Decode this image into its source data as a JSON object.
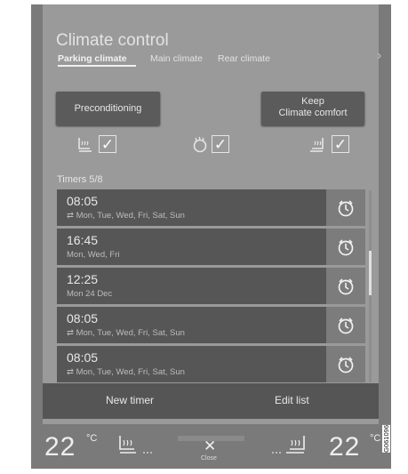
{
  "header": {
    "title": "Climate control",
    "tabs": [
      "Parking climate",
      "Main climate",
      "Rear climate"
    ]
  },
  "actions": {
    "preconditioning": "Preconditioning",
    "keep_comfort": "Keep\nClimate comfort"
  },
  "timers": {
    "label": "Timers 5/8",
    "items": [
      {
        "time": "08:05",
        "days": "Mon, Tue, Wed, Fri, Sat, Sun",
        "repeat": true
      },
      {
        "time": "16:45",
        "days": "Mon, Wed, Fri",
        "repeat": false
      },
      {
        "time": "12:25",
        "days": "Mon 24 Dec",
        "repeat": false
      },
      {
        "time": "08:05",
        "days": "Mon, Tue, Wed, Fri, Sat, Sun",
        "repeat": true
      },
      {
        "time": "08:05",
        "days": "Mon, Tue, Wed, Fri, Sat, Sun",
        "repeat": true
      }
    ]
  },
  "bottom": {
    "new_timer": "New timer",
    "edit_list": "Edit list"
  },
  "climate_bar": {
    "left_temp": "22",
    "right_temp": "22",
    "unit": "°C",
    "close_label": "Close"
  },
  "image_code": "G061096",
  "colors": {
    "screen": "#9a9a9a",
    "row": "#565656",
    "accent_text": "#f0f0f0"
  }
}
